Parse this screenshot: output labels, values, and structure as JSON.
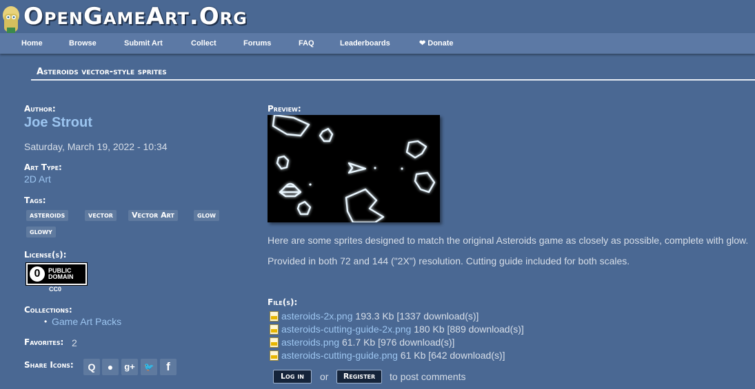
{
  "site": {
    "title": "OpenGameArt.Org"
  },
  "nav": {
    "items": [
      {
        "label": "Home"
      },
      {
        "label": "Browse"
      },
      {
        "label": "Submit Art"
      },
      {
        "label": "Collect"
      },
      {
        "label": "Forums"
      },
      {
        "label": "FAQ"
      },
      {
        "label": "Leaderboards"
      },
      {
        "label": "❤ Donate"
      }
    ]
  },
  "page": {
    "title": "Asteroids vector-style sprites"
  },
  "author": {
    "label": "Author:",
    "name": "Joe Strout"
  },
  "date": "Saturday, March 19, 2022 - 10:34",
  "art_type": {
    "label": "Art Type:",
    "value": "2D Art"
  },
  "tags": {
    "label": "Tags:",
    "items": [
      "asteroids",
      "vector",
      "Vector Art",
      "glow",
      "glowy"
    ]
  },
  "license": {
    "label": "License(s):",
    "badge_line1": "PUBLIC",
    "badge_line2": "DOMAIN",
    "badge_symbol": "0",
    "name": "CC0"
  },
  "collections": {
    "label": "Collections:",
    "items": [
      "Game Art Packs"
    ],
    "bullet": "•"
  },
  "favorites": {
    "label": "Favorites:",
    "count": "2"
  },
  "share": {
    "label": "Share Icons:",
    "icons": [
      {
        "name": "share-icon-q",
        "glyph": "Q"
      },
      {
        "name": "reddit-icon",
        "glyph": "●"
      },
      {
        "name": "google-plus-icon",
        "glyph": "g+"
      },
      {
        "name": "twitter-icon",
        "glyph": "🐦"
      },
      {
        "name": "facebook-icon",
        "glyph": "f"
      }
    ]
  },
  "preview": {
    "label": "Preview:"
  },
  "description": [
    "Here are some sprites designed to match the original Asteroids game as closely as possible, complete with glow.",
    "Provided in both 72 and 144 (\"2X\") resolution.  Cutting guide included for both scales."
  ],
  "files": {
    "label": "File(s):",
    "items": [
      {
        "name": "asteroids-2x.png",
        "meta": "193.3 Kb [1337 download(s)]"
      },
      {
        "name": "asteroids-cutting-guide-2x.png",
        "meta": "180 Kb [889 download(s)]"
      },
      {
        "name": "asteroids.png",
        "meta": "61.7 Kb [976 download(s)]"
      },
      {
        "name": "asteroids-cutting-guide.png",
        "meta": "61 Kb [642 download(s)]"
      }
    ]
  },
  "comments": {
    "login": "Log in",
    "or": "or",
    "register": "Register",
    "suffix": "to post comments"
  },
  "colors": {
    "background": "#4a6893",
    "navbar": "#5c79a5",
    "link": "#9cc5f0",
    "glow": "#bfe6ff"
  }
}
